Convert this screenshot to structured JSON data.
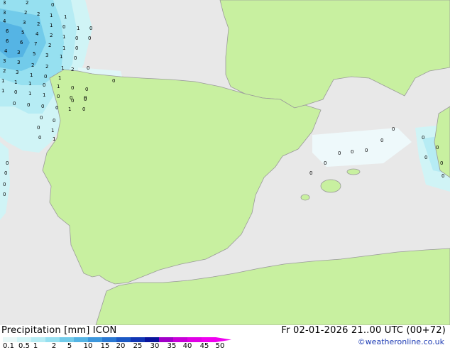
{
  "map": {
    "colors": {
      "sea": "#e8e8e8",
      "land": "#c8f0a0",
      "coast": "#9a9a9a"
    },
    "precip_labels": [
      "3",
      "2",
      "0",
      "3",
      "2",
      "2",
      "1",
      "1",
      "4",
      "3",
      "2",
      "1",
      "0",
      "1",
      "0",
      "6",
      "5",
      "4",
      "2",
      "1",
      "0",
      "0",
      "6",
      "6",
      "7",
      "2",
      "1",
      "0",
      "4",
      "3",
      "5",
      "3",
      "1",
      "0",
      "3",
      "3",
      "2",
      "2",
      "1",
      "2",
      "2",
      "3",
      "1",
      "0",
      "1",
      "1",
      "1",
      "1",
      "0",
      "1",
      "0",
      "1",
      "0",
      "1",
      "1",
      "0",
      "0",
      "0",
      "0",
      "0",
      "0",
      "0",
      "1",
      "0",
      "0",
      "0",
      "0",
      "1",
      "0",
      "1",
      "0",
      "0",
      "0",
      "0",
      "0",
      "0",
      "0",
      "0",
      "0",
      "0",
      "0",
      "0",
      "0",
      "0",
      "0",
      "0",
      "0",
      "0",
      "0",
      "0",
      "0"
    ]
  },
  "footer": {
    "title_left": "Precipitation [mm]  ICON",
    "title_right": "Fr 02-01-2026 21..00 UTC (00+72)",
    "credit": "©weatheronline.co.uk",
    "scale": {
      "labels": [
        "0.1",
        "0.5",
        "1",
        "2",
        "5",
        "10",
        "15",
        "20",
        "25",
        "30",
        "35",
        "40",
        "45",
        "50"
      ],
      "colors": [
        "#e8f8f8",
        "#d0f4f6",
        "#b6ecf4",
        "#96e0f0",
        "#72cbea",
        "#55b4e4",
        "#3c96dc",
        "#2a78d2",
        "#1c58c4",
        "#1236b4",
        "#0a149c",
        "#a000c8",
        "#c800d8",
        "#e000e6",
        "#f000f0"
      ]
    }
  }
}
